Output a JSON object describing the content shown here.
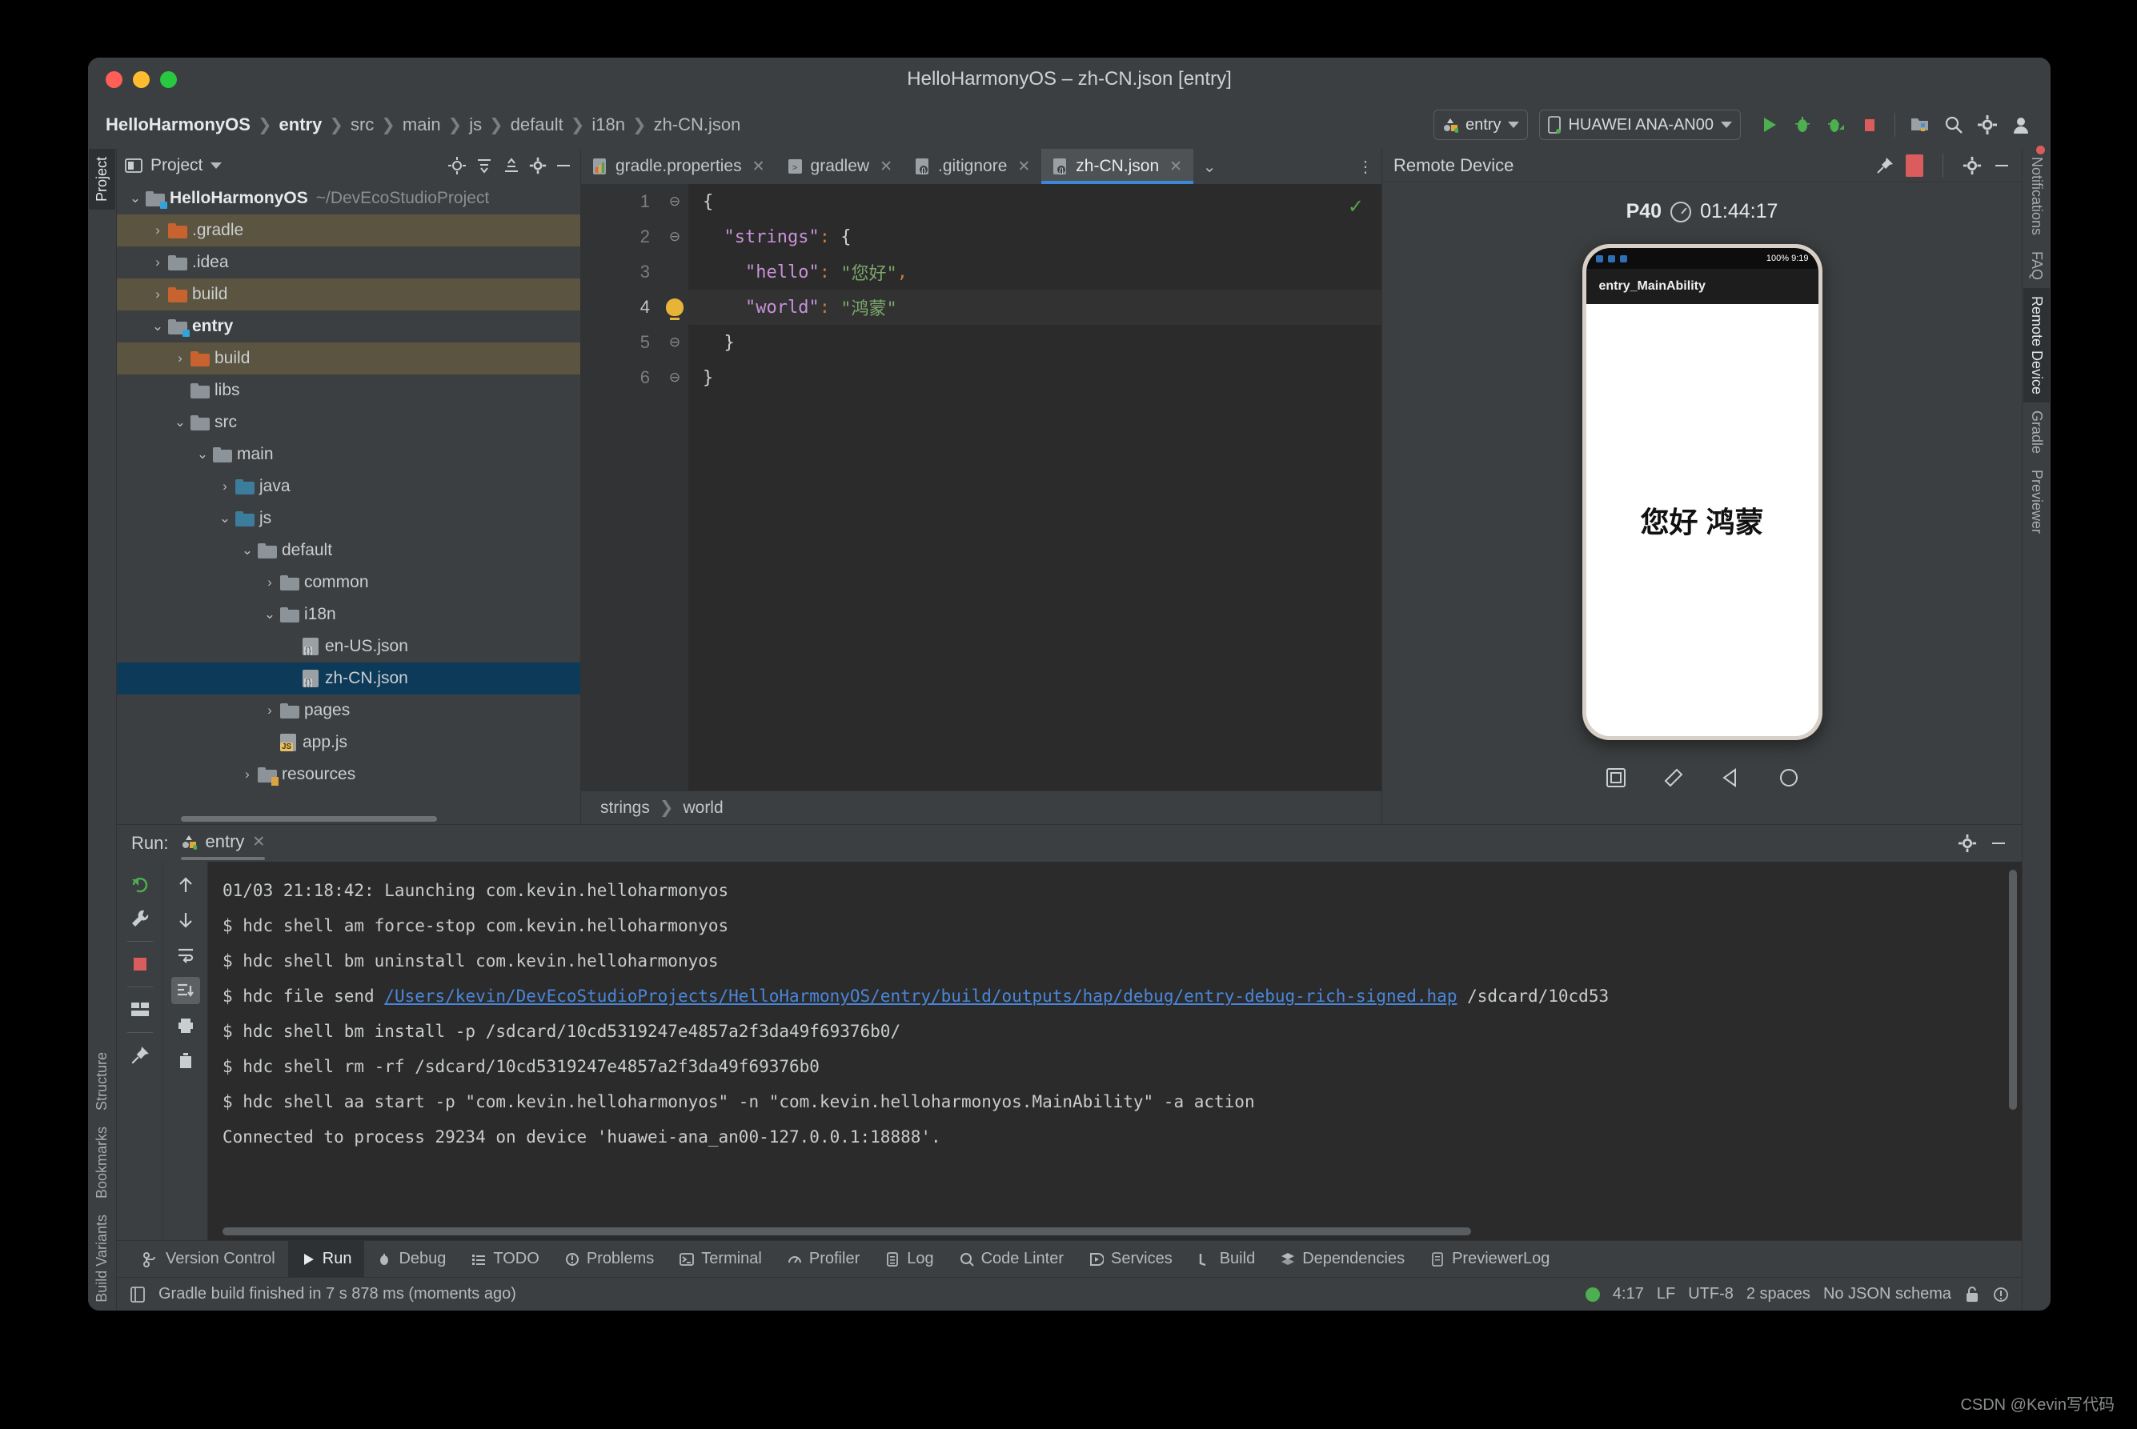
{
  "window": {
    "title": "HelloHarmonyOS – zh-CN.json [entry]"
  },
  "breadcrumb": {
    "items": [
      "HelloHarmonyOS",
      "entry",
      "src",
      "main",
      "js",
      "default",
      "i18n",
      "zh-CN.json"
    ],
    "separator": "❯"
  },
  "toolbar": {
    "run_config": "entry",
    "device": "HUAWEI ANA-AN00",
    "icons": [
      "run-icon",
      "debug-icon",
      "profile-icon",
      "stop-icon",
      "device-manager-icon",
      "search-icon",
      "settings-icon",
      "account-icon"
    ]
  },
  "left_rail": {
    "top": [
      "Project"
    ],
    "bottom": [
      "Structure",
      "Bookmarks",
      "Build Variants"
    ]
  },
  "right_rail": {
    "items": [
      "Notifications",
      "FAQ",
      "Remote Device",
      "Gradle",
      "Previewer"
    ],
    "active": "Remote Device"
  },
  "project_panel": {
    "title": "Project",
    "tree": [
      {
        "depth": 0,
        "twist": "⌄",
        "label": "HelloHarmonyOS",
        "path": "~/DevEcoStudioProject",
        "icon": "module-folder",
        "bold": true,
        "state": "normal"
      },
      {
        "depth": 1,
        "twist": "›",
        "label": ".gradle",
        "icon": "folder-orange",
        "state": "excluded"
      },
      {
        "depth": 1,
        "twist": "›",
        "label": ".idea",
        "icon": "folder-grey",
        "state": "normal"
      },
      {
        "depth": 1,
        "twist": "›",
        "label": "build",
        "icon": "folder-orange",
        "state": "excluded"
      },
      {
        "depth": 1,
        "twist": "⌄",
        "label": "entry",
        "icon": "module-folder",
        "bold": true,
        "state": "normal"
      },
      {
        "depth": 2,
        "twist": "›",
        "label": "build",
        "icon": "folder-orange",
        "state": "excluded"
      },
      {
        "depth": 2,
        "twist": "",
        "label": "libs",
        "icon": "folder-grey",
        "state": "normal"
      },
      {
        "depth": 2,
        "twist": "⌄",
        "label": "src",
        "icon": "folder-grey",
        "state": "normal"
      },
      {
        "depth": 3,
        "twist": "⌄",
        "label": "main",
        "icon": "folder-grey",
        "state": "normal"
      },
      {
        "depth": 4,
        "twist": "›",
        "label": "java",
        "icon": "folder-blue",
        "state": "normal"
      },
      {
        "depth": 4,
        "twist": "⌄",
        "label": "js",
        "icon": "folder-blue",
        "state": "normal"
      },
      {
        "depth": 5,
        "twist": "⌄",
        "label": "default",
        "icon": "folder-grey",
        "state": "normal"
      },
      {
        "depth": 6,
        "twist": "›",
        "label": "common",
        "icon": "folder-grey",
        "state": "normal"
      },
      {
        "depth": 6,
        "twist": "⌄",
        "label": "i18n",
        "icon": "folder-grey",
        "state": "normal"
      },
      {
        "depth": 7,
        "twist": "",
        "label": "en-US.json",
        "icon": "json-file",
        "state": "normal"
      },
      {
        "depth": 7,
        "twist": "",
        "label": "zh-CN.json",
        "icon": "json-file",
        "state": "selected"
      },
      {
        "depth": 6,
        "twist": "›",
        "label": "pages",
        "icon": "folder-grey",
        "state": "normal"
      },
      {
        "depth": 6,
        "twist": "",
        "label": "app.js",
        "icon": "js-file",
        "state": "normal"
      },
      {
        "depth": 5,
        "twist": "›",
        "label": "resources",
        "icon": "folder-res",
        "state": "normal"
      }
    ]
  },
  "editor": {
    "tabs": [
      {
        "label": "gradle.properties",
        "icon": "properties-icon",
        "active": false
      },
      {
        "label": "gradlew",
        "icon": "script-icon",
        "active": false
      },
      {
        "label": ".gitignore",
        "icon": "gitignore-icon",
        "active": false
      },
      {
        "label": "zh-CN.json",
        "icon": "json-icon",
        "active": true
      }
    ],
    "lines": [
      {
        "no": "1",
        "fold": "⊖",
        "segments": [
          {
            "t": "{",
            "c": "punc"
          }
        ]
      },
      {
        "no": "2",
        "fold": "⊖",
        "segments": [
          {
            "t": "  ",
            "c": "punc"
          },
          {
            "t": "\"strings\"",
            "c": "key"
          },
          {
            "t": ":",
            "c": "colon"
          },
          {
            "t": " {",
            "c": "punc"
          }
        ]
      },
      {
        "no": "3",
        "fold": "",
        "segments": [
          {
            "t": "    ",
            "c": "punc"
          },
          {
            "t": "\"hello\"",
            "c": "key"
          },
          {
            "t": ":",
            "c": "colon"
          },
          {
            "t": " ",
            "c": "punc"
          },
          {
            "t": "\"您好\"",
            "c": "str"
          },
          {
            "t": ",",
            "c": "comma"
          }
        ]
      },
      {
        "no": "4",
        "fold": "bulb",
        "current": true,
        "segments": [
          {
            "t": "    ",
            "c": "punc"
          },
          {
            "t": "\"world\"",
            "c": "key"
          },
          {
            "t": ":",
            "c": "colon"
          },
          {
            "t": " ",
            "c": "punc"
          },
          {
            "t": "\"鸿蒙\"",
            "c": "str"
          }
        ]
      },
      {
        "no": "5",
        "fold": "⊖",
        "segments": [
          {
            "t": "  }",
            "c": "punc"
          }
        ]
      },
      {
        "no": "6",
        "fold": "⊖",
        "segments": [
          {
            "t": "}",
            "c": "punc"
          }
        ]
      }
    ],
    "status_check": "✓",
    "structure_crumb": [
      "strings",
      "world"
    ]
  },
  "device_panel": {
    "title": "Remote Device",
    "device_name": "P40",
    "timer": "01:44:17",
    "phone": {
      "status_battery": "100%",
      "status_time": "9:19",
      "app_title": "entry_MainAbility",
      "content_text": "您好 鸿蒙"
    },
    "nav_buttons": [
      "screenshot-icon",
      "record-icon",
      "back-icon",
      "home-icon"
    ]
  },
  "run_panel": {
    "label": "Run:",
    "tab": "entry",
    "tools_left": [
      "rerun-icon",
      "wrench-icon",
      "stop-icon",
      "layout-icon",
      "pin-icon"
    ],
    "tools_right": [
      "up-icon",
      "down-icon",
      "soft-wrap-icon",
      "scroll-to-end-icon",
      "print-icon",
      "trash-icon"
    ],
    "console": [
      [
        {
          "t": "01/03 21:18:42: Launching com.kevin.helloharmonyos"
        }
      ],
      [
        {
          "t": "$ hdc shell am force-stop com.kevin.helloharmonyos"
        }
      ],
      [
        {
          "t": "$ hdc shell bm uninstall com.kevin.helloharmonyos"
        }
      ],
      [
        {
          "t": "$ hdc file send "
        },
        {
          "t": "/Users/kevin/DevEcoStudioProjects/HelloHarmonyOS/entry/build/outputs/hap/debug/entry-debug-rich-signed.hap",
          "link": true
        },
        {
          "t": " /sdcard/10cd53"
        }
      ],
      [
        {
          "t": "$ hdc shell bm install -p /sdcard/10cd5319247e4857a2f3da49f69376b0/"
        }
      ],
      [
        {
          "t": "$ hdc shell rm -rf /sdcard/10cd5319247e4857a2f3da49f69376b0"
        }
      ],
      [
        {
          "t": "$ hdc shell aa start -p \"com.kevin.helloharmonyos\" -n \"com.kevin.helloharmonyos.MainAbility\" -a action"
        }
      ],
      [
        {
          "t": "Connected to process 29234 on device 'huawei-ana_an00-127.0.0.1:18888'."
        }
      ]
    ]
  },
  "toolwindow_bar": {
    "items": [
      {
        "label": "Version Control",
        "icon": "vcs-icon",
        "active": false
      },
      {
        "label": "Run",
        "icon": "run-icon",
        "active": true
      },
      {
        "label": "Debug",
        "icon": "debug-icon",
        "active": false
      },
      {
        "label": "TODO",
        "icon": "todo-icon",
        "active": false
      },
      {
        "label": "Problems",
        "icon": "problems-icon",
        "active": false
      },
      {
        "label": "Terminal",
        "icon": "terminal-icon",
        "active": false
      },
      {
        "label": "Profiler",
        "icon": "profiler-icon",
        "active": false
      },
      {
        "label": "Log",
        "icon": "log-icon",
        "active": false
      },
      {
        "label": "Code Linter",
        "icon": "linter-icon",
        "active": false
      },
      {
        "label": "Services",
        "icon": "services-icon",
        "active": false
      },
      {
        "label": "Build",
        "icon": "build-icon",
        "active": false
      },
      {
        "label": "Dependencies",
        "icon": "dependencies-icon",
        "active": false
      },
      {
        "label": "PreviewerLog",
        "icon": "previewerlog-icon",
        "active": false
      }
    ]
  },
  "statusbar": {
    "message": "Gradle build finished in 7 s 878 ms (moments ago)",
    "caret": "4:17",
    "line_sep": "LF",
    "encoding": "UTF-8",
    "indent": "2 spaces",
    "schema": "No JSON schema"
  },
  "watermark": "CSDN @Kevin写代码",
  "colors": {
    "accent_blue": "#3b88d8",
    "selection": "#0d3a58",
    "excluded": "#5a5440",
    "string_green": "#7ba86b",
    "key_purple": "#c792d8",
    "stop_red": "#db5c5c",
    "ok_green": "#4caf50"
  }
}
